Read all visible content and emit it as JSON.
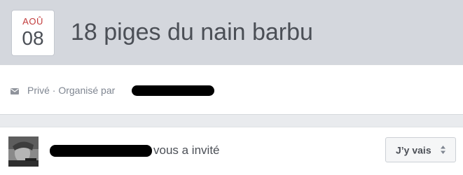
{
  "event": {
    "month": "AOÛ",
    "day": "08",
    "title": "18 piges du nain barbu"
  },
  "info": {
    "icon": "envelope-icon",
    "privacy_text": "Privé · Organisé par"
  },
  "invitation": {
    "invite_text": "vous a invité",
    "rsvp_label": "J’y vais",
    "rsvp_icon": "sort-arrows-icon"
  },
  "colors": {
    "month_red": "#c23b3b",
    "header_bg": "#d4d7dd",
    "text_dark": "#4b4f56"
  }
}
